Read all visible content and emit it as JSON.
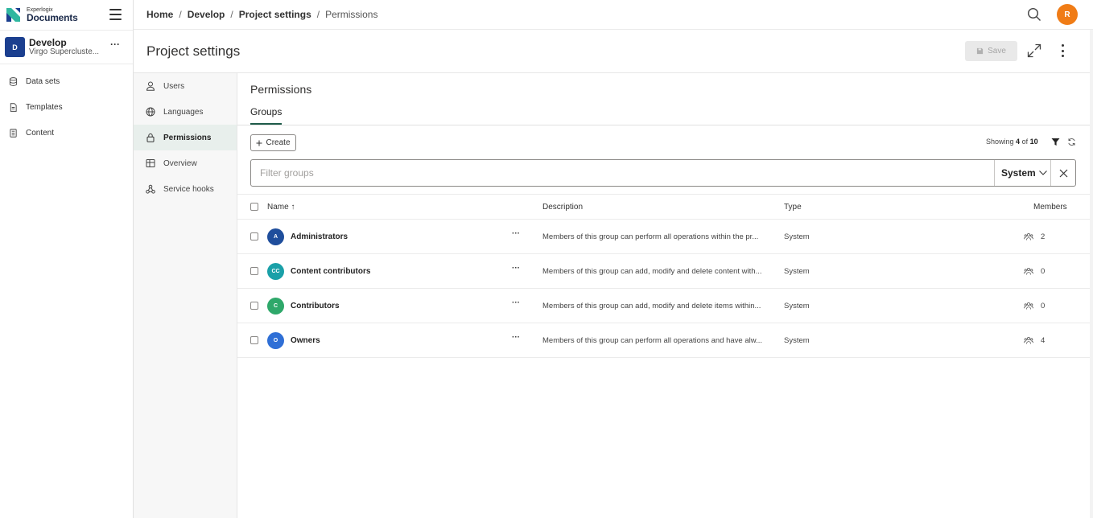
{
  "brand": {
    "small": "Experlogix",
    "name": "Documents"
  },
  "project": {
    "badge": "D",
    "name": "Develop",
    "subtitle": "Virgo Supercluste...",
    "more": "···"
  },
  "sidebar": {
    "items": [
      {
        "label": "Data sets",
        "icon": "database-icon"
      },
      {
        "label": "Templates",
        "icon": "document-icon"
      },
      {
        "label": "Content",
        "icon": "content-icon"
      }
    ]
  },
  "breadcrumb": {
    "items": [
      "Home",
      "Develop",
      "Project settings"
    ],
    "current": "Permissions",
    "separator": "/"
  },
  "user": {
    "initial": "R",
    "color": "#f07c16"
  },
  "page": {
    "title": "Project settings",
    "save_label": "Save"
  },
  "settings_nav": {
    "items": [
      {
        "label": "Users",
        "icon": "user-icon",
        "active": false
      },
      {
        "label": "Languages",
        "icon": "globe-icon",
        "active": false
      },
      {
        "label": "Permissions",
        "icon": "lock-icon",
        "active": true
      },
      {
        "label": "Overview",
        "icon": "grid-icon",
        "active": false
      },
      {
        "label": "Service hooks",
        "icon": "webhook-icon",
        "active": false
      }
    ]
  },
  "permissions": {
    "title": "Permissions",
    "tab": "Groups",
    "create_label": "Create",
    "showing_prefix": "Showing",
    "showing_count": "4",
    "showing_of": "of",
    "showing_total": "10",
    "filter_placeholder": "Filter groups",
    "filter_type": "System"
  },
  "table": {
    "headers": {
      "name": "Name ↑",
      "description": "Description",
      "type": "Type",
      "members": "Members"
    },
    "rows": [
      {
        "initials": "A",
        "color": "#1f4e9c",
        "name": "Administrators",
        "more": "···",
        "description": "Members of this group can perform all operations within the pr...",
        "type": "System",
        "members": "2"
      },
      {
        "initials": "CC",
        "color": "#1aa0a8",
        "name": "Content contributors",
        "more": "···",
        "description": "Members of this group can add, modify and delete content with...",
        "type": "System",
        "members": "0"
      },
      {
        "initials": "C",
        "color": "#2ea86a",
        "name": "Contributors",
        "more": "···",
        "description": "Members of this group can add, modify and delete items within...",
        "type": "System",
        "members": "0"
      },
      {
        "initials": "O",
        "color": "#2f6fd6",
        "name": "Owners",
        "more": "···",
        "description": "Members of this group can perform all operations and have alw...",
        "type": "System",
        "members": "4"
      }
    ]
  },
  "colors": {
    "accent": "#1f5c4a",
    "brand_navy": "#1b3f8f"
  }
}
